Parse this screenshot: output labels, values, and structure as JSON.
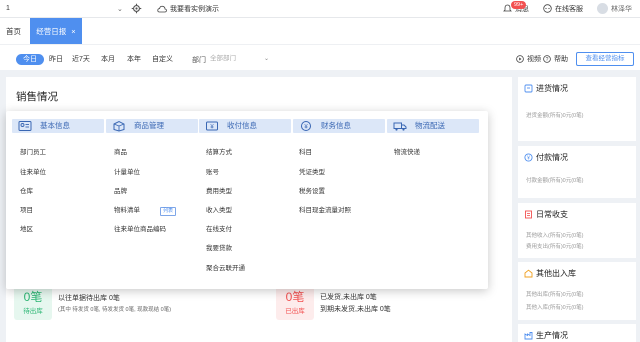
{
  "topbar": {
    "selector_value": "1",
    "demo_label": "我要看实例演示",
    "messages_label": "消息",
    "messages_badge": "99+",
    "service_label": "在线客服",
    "user_name": "林泽华"
  },
  "tabs": {
    "home": "首页",
    "active": "经营日报",
    "close": "×"
  },
  "filters": {
    "periods": [
      "今日",
      "昨日",
      "近7天",
      "本月",
      "本年",
      "自定义"
    ],
    "dept_label": "部门",
    "dept_placeholder": "全部部门",
    "video_label": "视频",
    "help_label": "帮助",
    "view_button": "查看经营指标"
  },
  "sales": {
    "title": "销售情况"
  },
  "right_cards": [
    {
      "title": "进货情况",
      "line1": "进货金额(所有)0元(0笔)"
    },
    {
      "title": "付款情况",
      "line1": "付款金额(所有)0元(0笔)"
    },
    {
      "title": "日常收支",
      "line1": "其他收入(所有)0元(0笔)",
      "line2": "费用支出(所有)0元(0笔)"
    },
    {
      "title": "其他出入库",
      "line1": "其他出库(所有)0元(0笔)",
      "line2": "其他入库(所有)0元(0笔)"
    },
    {
      "title": "生产情况"
    }
  ],
  "bottom": {
    "left": {
      "num": "0笔",
      "label": "待出库",
      "line1": "以往单据待出库 0笔",
      "line2": "(其中 待发货 0笔, 待发发货 0笔, 现款现结 0笔)"
    },
    "right": {
      "num": "0笔",
      "label": "已出库",
      "line1": "已发货,未出库 0笔",
      "line2": "到期未发货,未出库 0笔"
    }
  },
  "menu": {
    "columns": [
      {
        "title": "基本信息",
        "icon": "basic-info-icon",
        "items": [
          "部门员工",
          "往来单位",
          "仓库",
          "项目",
          "地区"
        ]
      },
      {
        "title": "商品管理",
        "icon": "product-icon",
        "items": [
          "商品",
          "计量单位",
          "品牌",
          "物料清单",
          "往来单位商品编码"
        ],
        "tag": "列表"
      },
      {
        "title": "收付信息",
        "icon": "payment-icon",
        "items": [
          "结算方式",
          "账号",
          "费用类型",
          "收入类型",
          "在线支付",
          "我要贷款",
          "聚合云联开通"
        ]
      },
      {
        "title": "财务信息",
        "icon": "finance-icon",
        "items": [
          "科目",
          "凭证类型",
          "税务设置",
          "科目现金流量对照"
        ]
      },
      {
        "title": "物流配送",
        "icon": "logistics-icon",
        "items": [
          "物流快递"
        ]
      }
    ]
  },
  "colors": {
    "accent": "#4f8fef",
    "header_bg": "#dce7f8",
    "warn": "#f25050"
  }
}
